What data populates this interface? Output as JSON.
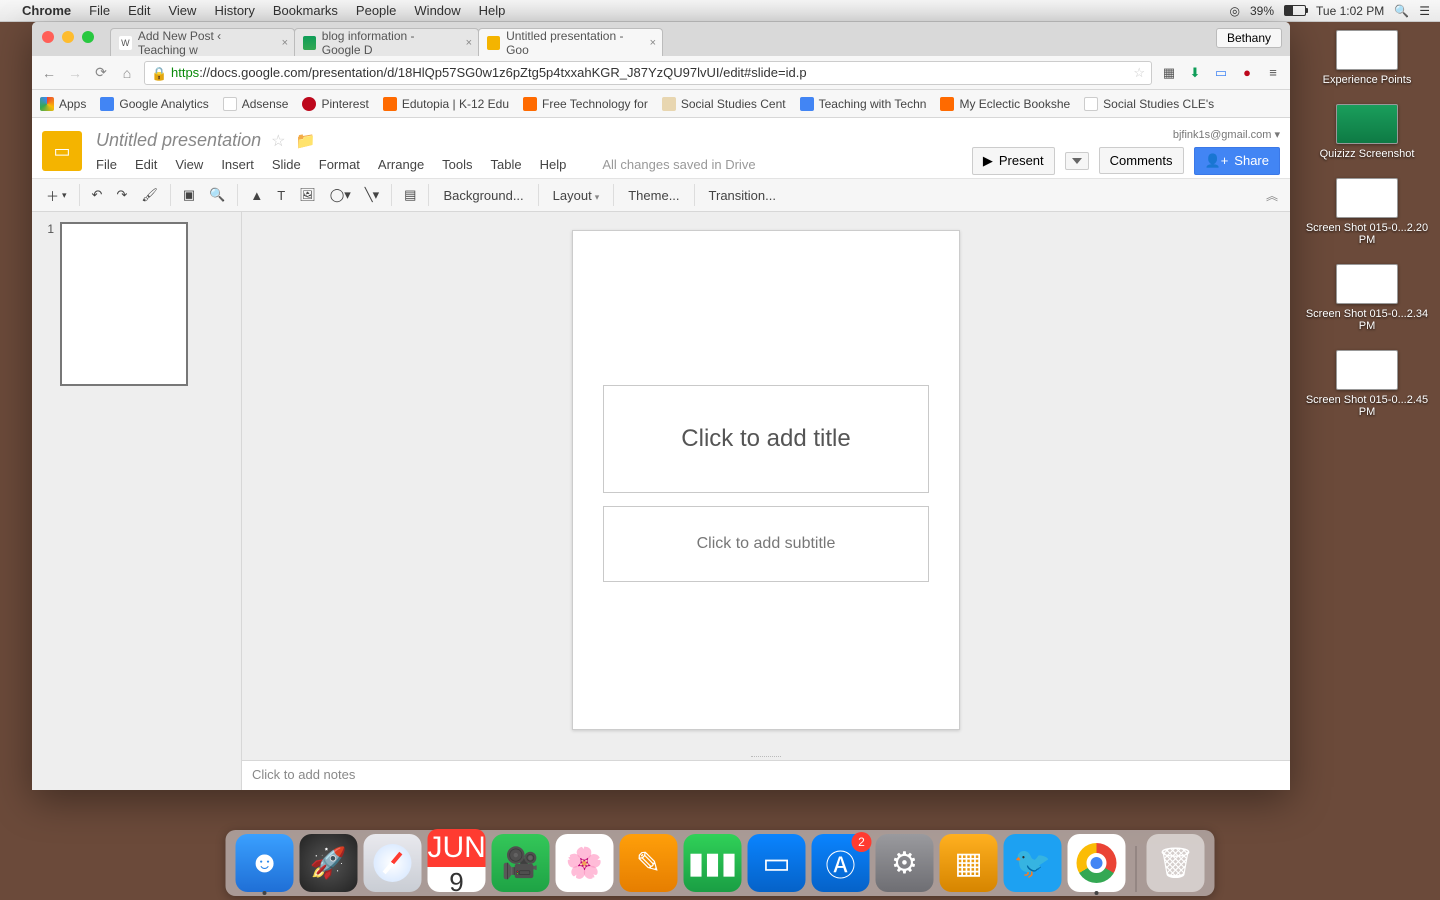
{
  "menubar": {
    "app": "Chrome",
    "items": [
      "File",
      "Edit",
      "View",
      "History",
      "Bookmarks",
      "People",
      "Window",
      "Help"
    ],
    "battery": "39%",
    "clock": "Tue 1:02 PM"
  },
  "chrome": {
    "profile": "Bethany",
    "tabs": [
      {
        "title": "Add New Post ‹ Teaching w",
        "favicon": "W"
      },
      {
        "title": "blog information - Google D",
        "favicon": "▲"
      },
      {
        "title": "Untitled presentation - Goo",
        "favicon": "▢",
        "active": true
      }
    ],
    "url_prefix": "https",
    "url_rest": "://docs.google.com/presentation/d/18HlQp57SG0w1z6pZtg5p4txxahKGR_J87YzQU97lvUI/edit#slide=id.p",
    "bookmarks": [
      {
        "label": "Apps",
        "bg": "linear-gradient(#ea4335 0 33%,#34a853 33% 66%,#fbbc05 66%)"
      },
      {
        "label": "Google Analytics",
        "bg": "#4285f4"
      },
      {
        "label": "Adsense",
        "bg": "#e8e8e8"
      },
      {
        "label": "Pinterest",
        "bg": "#bd081c"
      },
      {
        "label": "Edutopia | K-12 Edu",
        "bg": "#ff6a00"
      },
      {
        "label": "Free Technology for",
        "bg": "#ff6a00"
      },
      {
        "label": "Social Studies Cent",
        "bg": "#e8d6b0"
      },
      {
        "label": "Teaching with Techn",
        "bg": "#4285f4"
      },
      {
        "label": "My Eclectic Bookshe",
        "bg": "#ff6a00"
      },
      {
        "label": "Social Studies CLE's",
        "bg": "#eee"
      }
    ]
  },
  "slides": {
    "account": "bjfink1s@gmail.com",
    "title": "Untitled presentation",
    "menus": [
      "File",
      "Edit",
      "View",
      "Insert",
      "Slide",
      "Format",
      "Arrange",
      "Tools",
      "Table",
      "Help"
    ],
    "save_status": "All changes saved in Drive",
    "present": "Present",
    "comments": "Comments",
    "share": "Share",
    "toolbar": {
      "background": "Background...",
      "layout": "Layout",
      "theme": "Theme...",
      "transition": "Transition..."
    },
    "thumb_number": "1",
    "title_ph": "Click to add title",
    "subtitle_ph": "Click to add subtitle",
    "notes_ph": "Click to add notes"
  },
  "desktop": [
    {
      "label": "Experience Points",
      "cls": ""
    },
    {
      "label": "Quizizz Screenshot",
      "cls": "green"
    },
    {
      "label": "Screen Shot 015-0...2.20 PM",
      "cls": ""
    },
    {
      "label": "Screen Shot 015-0...2.34 PM",
      "cls": ""
    },
    {
      "label": "Screen Shot 015-0...2.45 PM",
      "cls": ""
    }
  ],
  "dock": {
    "cal_month": "JUN",
    "cal_day": "9",
    "appstore_badge": "2"
  }
}
